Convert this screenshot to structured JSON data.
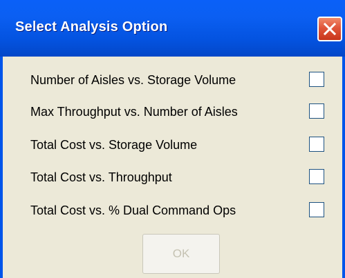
{
  "window": {
    "title": "Select Analysis Option",
    "close_icon": "close-icon"
  },
  "options": [
    {
      "label": "Number of Aisles vs. Storage Volume",
      "checked": false
    },
    {
      "label": "Max Throughput vs. Number of Aisles",
      "checked": false
    },
    {
      "label": "Total Cost vs. Storage Volume",
      "checked": false
    },
    {
      "label": "Total Cost vs. Throughput",
      "checked": false
    },
    {
      "label": "Total Cost vs. % Dual Command Ops",
      "checked": false
    }
  ],
  "ok_button": {
    "label": "OK",
    "enabled": false
  },
  "colors": {
    "titlebar": "#0454e4",
    "dialog_bg": "#ece9d8",
    "close_button": "#e0553a",
    "disabled_text": "#c5c2b2"
  }
}
